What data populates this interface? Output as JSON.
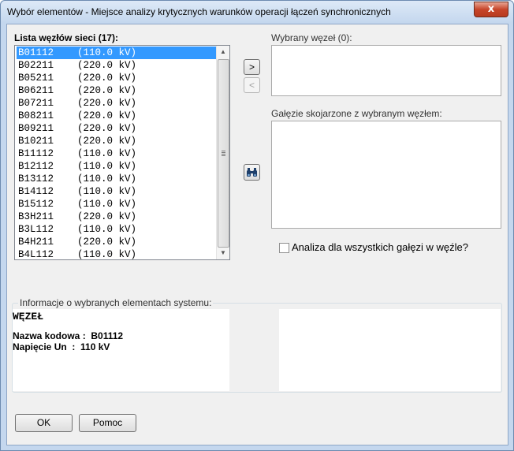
{
  "window": {
    "title": "Wybór elementów - Miejsce analizy krytycznych warunków operacji łączeń synchronicznych",
    "close_glyph": "x"
  },
  "node_list": {
    "label": "Lista węzłów sieci (17):",
    "selected_index": 0,
    "items": [
      {
        "code": "B01112",
        "voltage": "(110.0 kV)"
      },
      {
        "code": "B02211",
        "voltage": "(220.0 kV)"
      },
      {
        "code": "B05211",
        "voltage": "(220.0 kV)"
      },
      {
        "code": "B06211",
        "voltage": "(220.0 kV)"
      },
      {
        "code": "B07211",
        "voltage": "(220.0 kV)"
      },
      {
        "code": "B08211",
        "voltage": "(220.0 kV)"
      },
      {
        "code": "B09211",
        "voltage": "(220.0 kV)"
      },
      {
        "code": "B10211",
        "voltage": "(220.0 kV)"
      },
      {
        "code": "B11112",
        "voltage": "(110.0 kV)"
      },
      {
        "code": "B12112",
        "voltage": "(110.0 kV)"
      },
      {
        "code": "B13112",
        "voltage": "(110.0 kV)"
      },
      {
        "code": "B14112",
        "voltage": "(110.0 kV)"
      },
      {
        "code": "B15112",
        "voltage": "(110.0 kV)"
      },
      {
        "code": "B3H211",
        "voltage": "(220.0 kV)"
      },
      {
        "code": "B3L112",
        "voltage": "(110.0 kV)"
      },
      {
        "code": "B4H211",
        "voltage": "(220.0 kV)"
      },
      {
        "code": "B4L112",
        "voltage": "(110.0 kV)"
      }
    ]
  },
  "transfer": {
    "add_label": ">",
    "remove_label": "<"
  },
  "selected_node": {
    "label": "Wybrany węzeł (0):"
  },
  "branches": {
    "label": "Gałęzie skojarzone z wybranym węzłem:"
  },
  "find_icon": "binoculars-icon",
  "all_branches_checkbox": {
    "label": "Analiza dla wszystkich gałęzi w węźle?",
    "checked": false
  },
  "info": {
    "label": "Informacje o wybranych elementach systemu:",
    "title": "WĘZEŁ",
    "line1": "Nazwa kodowa :  B01112",
    "line2": "Napięcie Un  :  110 kV"
  },
  "buttons": {
    "ok": "OK",
    "help": "Pomoc"
  }
}
